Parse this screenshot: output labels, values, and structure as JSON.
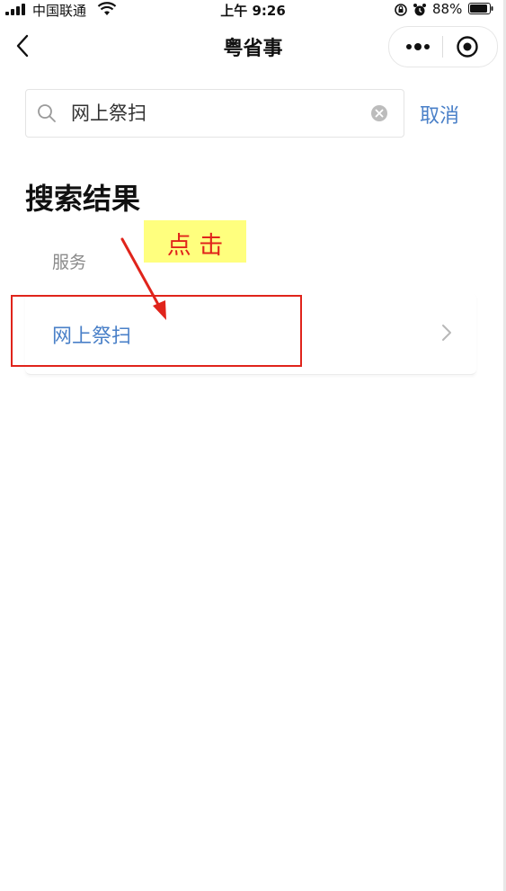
{
  "status_bar": {
    "carrier": "中国联通",
    "time": "上午 9:26",
    "battery": "88%"
  },
  "nav": {
    "title": "粤省事",
    "more_icon": "more-dots-icon",
    "target_icon": "target-icon",
    "back_icon": "chevron-left-icon"
  },
  "search": {
    "value": "网上祭扫",
    "cancel_label": "取消"
  },
  "results": {
    "title": "搜索结果",
    "section_label": "服务",
    "items": [
      {
        "label": "网上祭扫"
      }
    ]
  },
  "annotation": {
    "note": "点 击"
  },
  "colors": {
    "accent": "#4a80c8",
    "annotation_red": "#e0241b",
    "note_yellow": "#ffff7e"
  }
}
